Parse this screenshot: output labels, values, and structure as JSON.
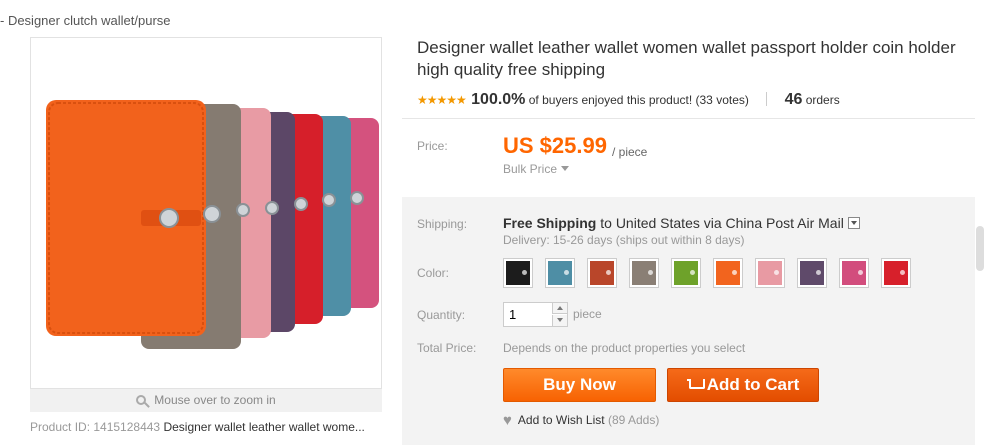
{
  "breadcrumb": {
    "text": "- Designer clutch wallet/purse"
  },
  "gallery": {
    "zoom_hint": "Mouse over to zoom in",
    "product_id_label": "Product ID: 1415128443",
    "product_name_short": "Designer wallet leather wallet wome..."
  },
  "product": {
    "title": "Designer wallet leather wallet women wallet passport holder coin holder high quality free shipping",
    "rating_stars": "★★★★★",
    "rating_percent": "100.0%",
    "rating_text": "of buyers enjoyed this product! (33 votes)",
    "orders_count": "46",
    "orders_label": "orders"
  },
  "price": {
    "label": "Price:",
    "value": "US $25.99",
    "unit": "/ piece",
    "bulk_label": "Bulk Price"
  },
  "shipping": {
    "label": "Shipping:",
    "free": "Free Shipping",
    "to": "to",
    "destination": "United States via China Post Air Mail",
    "delivery": "Delivery: 15-26 days (ships out within 8 days)"
  },
  "color": {
    "label": "Color:",
    "swatches": [
      "#1c1c1c",
      "#4e8ea5",
      "#b9462a",
      "#8a7f75",
      "#6ea22a",
      "#f2641e",
      "#e89aa3",
      "#5f4a6a",
      "#d24d7d",
      "#d7202b"
    ]
  },
  "quantity": {
    "label": "Quantity:",
    "value": "1",
    "unit": "piece"
  },
  "total": {
    "label": "Total Price:",
    "text": "Depends on the product properties you select"
  },
  "actions": {
    "buy_now": "Buy Now",
    "add_to_cart": "Add to Cart"
  },
  "wishlist": {
    "label": "Add to Wish List",
    "count": "(89 Adds)"
  },
  "colors": {
    "accent": "#ff6600",
    "panel": "#f3f3f3",
    "star": "#f39800"
  }
}
